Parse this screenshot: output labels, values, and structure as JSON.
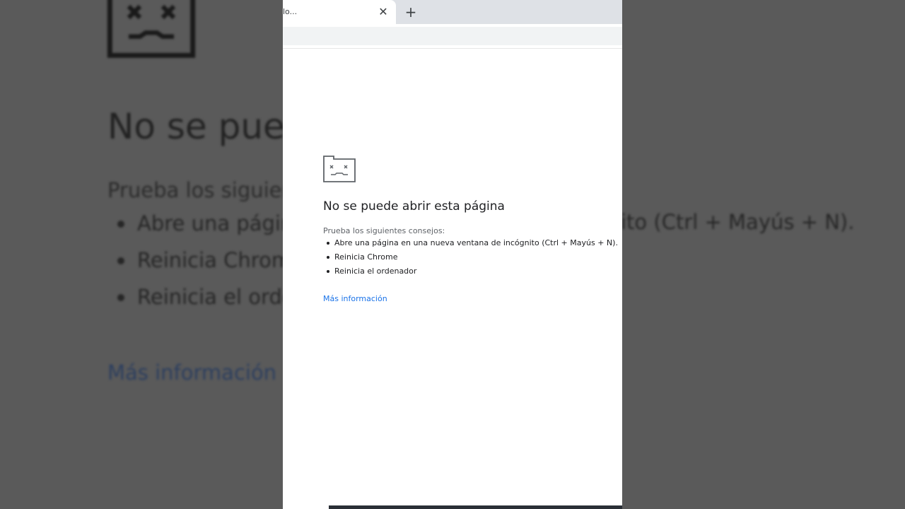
{
  "browser": {
    "tab_title": "lo...",
    "tab_close_glyph": "✕",
    "new_tab_glyph": "+"
  },
  "error_page": {
    "title": "No se puede abrir esta página",
    "intro": "Prueba los siguientes consejos:",
    "suggestions": [
      "Abre una página en una nueva ventana de incógnito (Ctrl + Mayús + N).",
      "Reinicia Chrome",
      "Reinicia el ordenador"
    ],
    "more_info_link": "Más información",
    "icon": "sad-tab-icon"
  },
  "background_blur": {
    "title": "No se pued",
    "intro": "Prueba los siguien",
    "suggestions": [
      "Abre una págin",
      "Reinicia Chrom",
      "Reinicia el orde"
    ],
    "tail_text": "ito (Ctrl + Mayús + N).",
    "more_info_link": "Más información"
  },
  "colors": {
    "link": "#1a73e8",
    "tabstrip": "#dee1e6",
    "backdrop": "#4a4a4a"
  }
}
